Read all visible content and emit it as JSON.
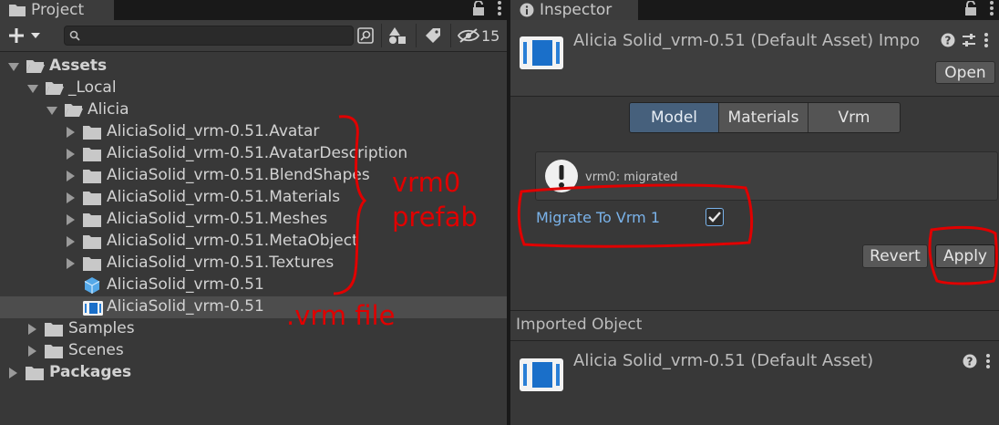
{
  "project": {
    "tab_label": "Project",
    "search_placeholder": "",
    "hidden_count": "15",
    "tree": [
      {
        "label": "Assets",
        "depth": 0,
        "kind": "folder-open",
        "arrow": "down",
        "bold": true
      },
      {
        "label": "_Local",
        "depth": 1,
        "kind": "folder-open",
        "arrow": "down",
        "bold": false
      },
      {
        "label": "Alicia",
        "depth": 2,
        "kind": "folder-open",
        "arrow": "down",
        "bold": false
      },
      {
        "label": "AliciaSolid_vrm-0.51.Avatar",
        "depth": 3,
        "kind": "folder",
        "arrow": "right",
        "bold": false
      },
      {
        "label": "AliciaSolid_vrm-0.51.AvatarDescription",
        "depth": 3,
        "kind": "folder",
        "arrow": "right",
        "bold": false
      },
      {
        "label": "AliciaSolid_vrm-0.51.BlendShapes",
        "depth": 3,
        "kind": "folder",
        "arrow": "right",
        "bold": false
      },
      {
        "label": "AliciaSolid_vrm-0.51.Materials",
        "depth": 3,
        "kind": "folder",
        "arrow": "right",
        "bold": false
      },
      {
        "label": "AliciaSolid_vrm-0.51.Meshes",
        "depth": 3,
        "kind": "folder",
        "arrow": "right",
        "bold": false
      },
      {
        "label": "AliciaSolid_vrm-0.51.MetaObject",
        "depth": 3,
        "kind": "folder",
        "arrow": "right",
        "bold": false
      },
      {
        "label": "AliciaSolid_vrm-0.51.Textures",
        "depth": 3,
        "kind": "folder",
        "arrow": "right",
        "bold": false
      },
      {
        "label": "AliciaSolid_vrm-0.51",
        "depth": 3,
        "kind": "prefab",
        "arrow": "none",
        "bold": false
      },
      {
        "label": "AliciaSolid_vrm-0.51",
        "depth": 3,
        "kind": "vrm-file",
        "arrow": "none",
        "bold": false,
        "selected": true
      },
      {
        "label": "Samples",
        "depth": 1,
        "kind": "folder",
        "arrow": "right",
        "bold": false
      },
      {
        "label": "Scenes",
        "depth": 1,
        "kind": "folder",
        "arrow": "right",
        "bold": false
      },
      {
        "label": "Packages",
        "depth": 0,
        "kind": "folder",
        "arrow": "right",
        "bold": true
      }
    ]
  },
  "inspector": {
    "tab_label": "Inspector",
    "asset_title": "Alicia Solid_vrm-0.51 (Default Asset) Impo",
    "open_label": "Open",
    "tabs": [
      {
        "label": "Model",
        "active": true
      },
      {
        "label": "Materials",
        "active": false
      },
      {
        "label": "Vrm",
        "active": false
      }
    ],
    "help_message": "vrm0: migrated",
    "migrate_label": "Migrate To Vrm 1",
    "migrate_checked": true,
    "revert_label": "Revert",
    "apply_label": "Apply",
    "imported_header": "Imported Object",
    "imported_title": "Alicia Solid_vrm-0.51 (Default Asset)"
  },
  "annotations": {
    "prefab_line1": "vrm0",
    "prefab_line2": "prefab",
    "vrm_file": ".vrm file",
    "color": "#e00000"
  }
}
